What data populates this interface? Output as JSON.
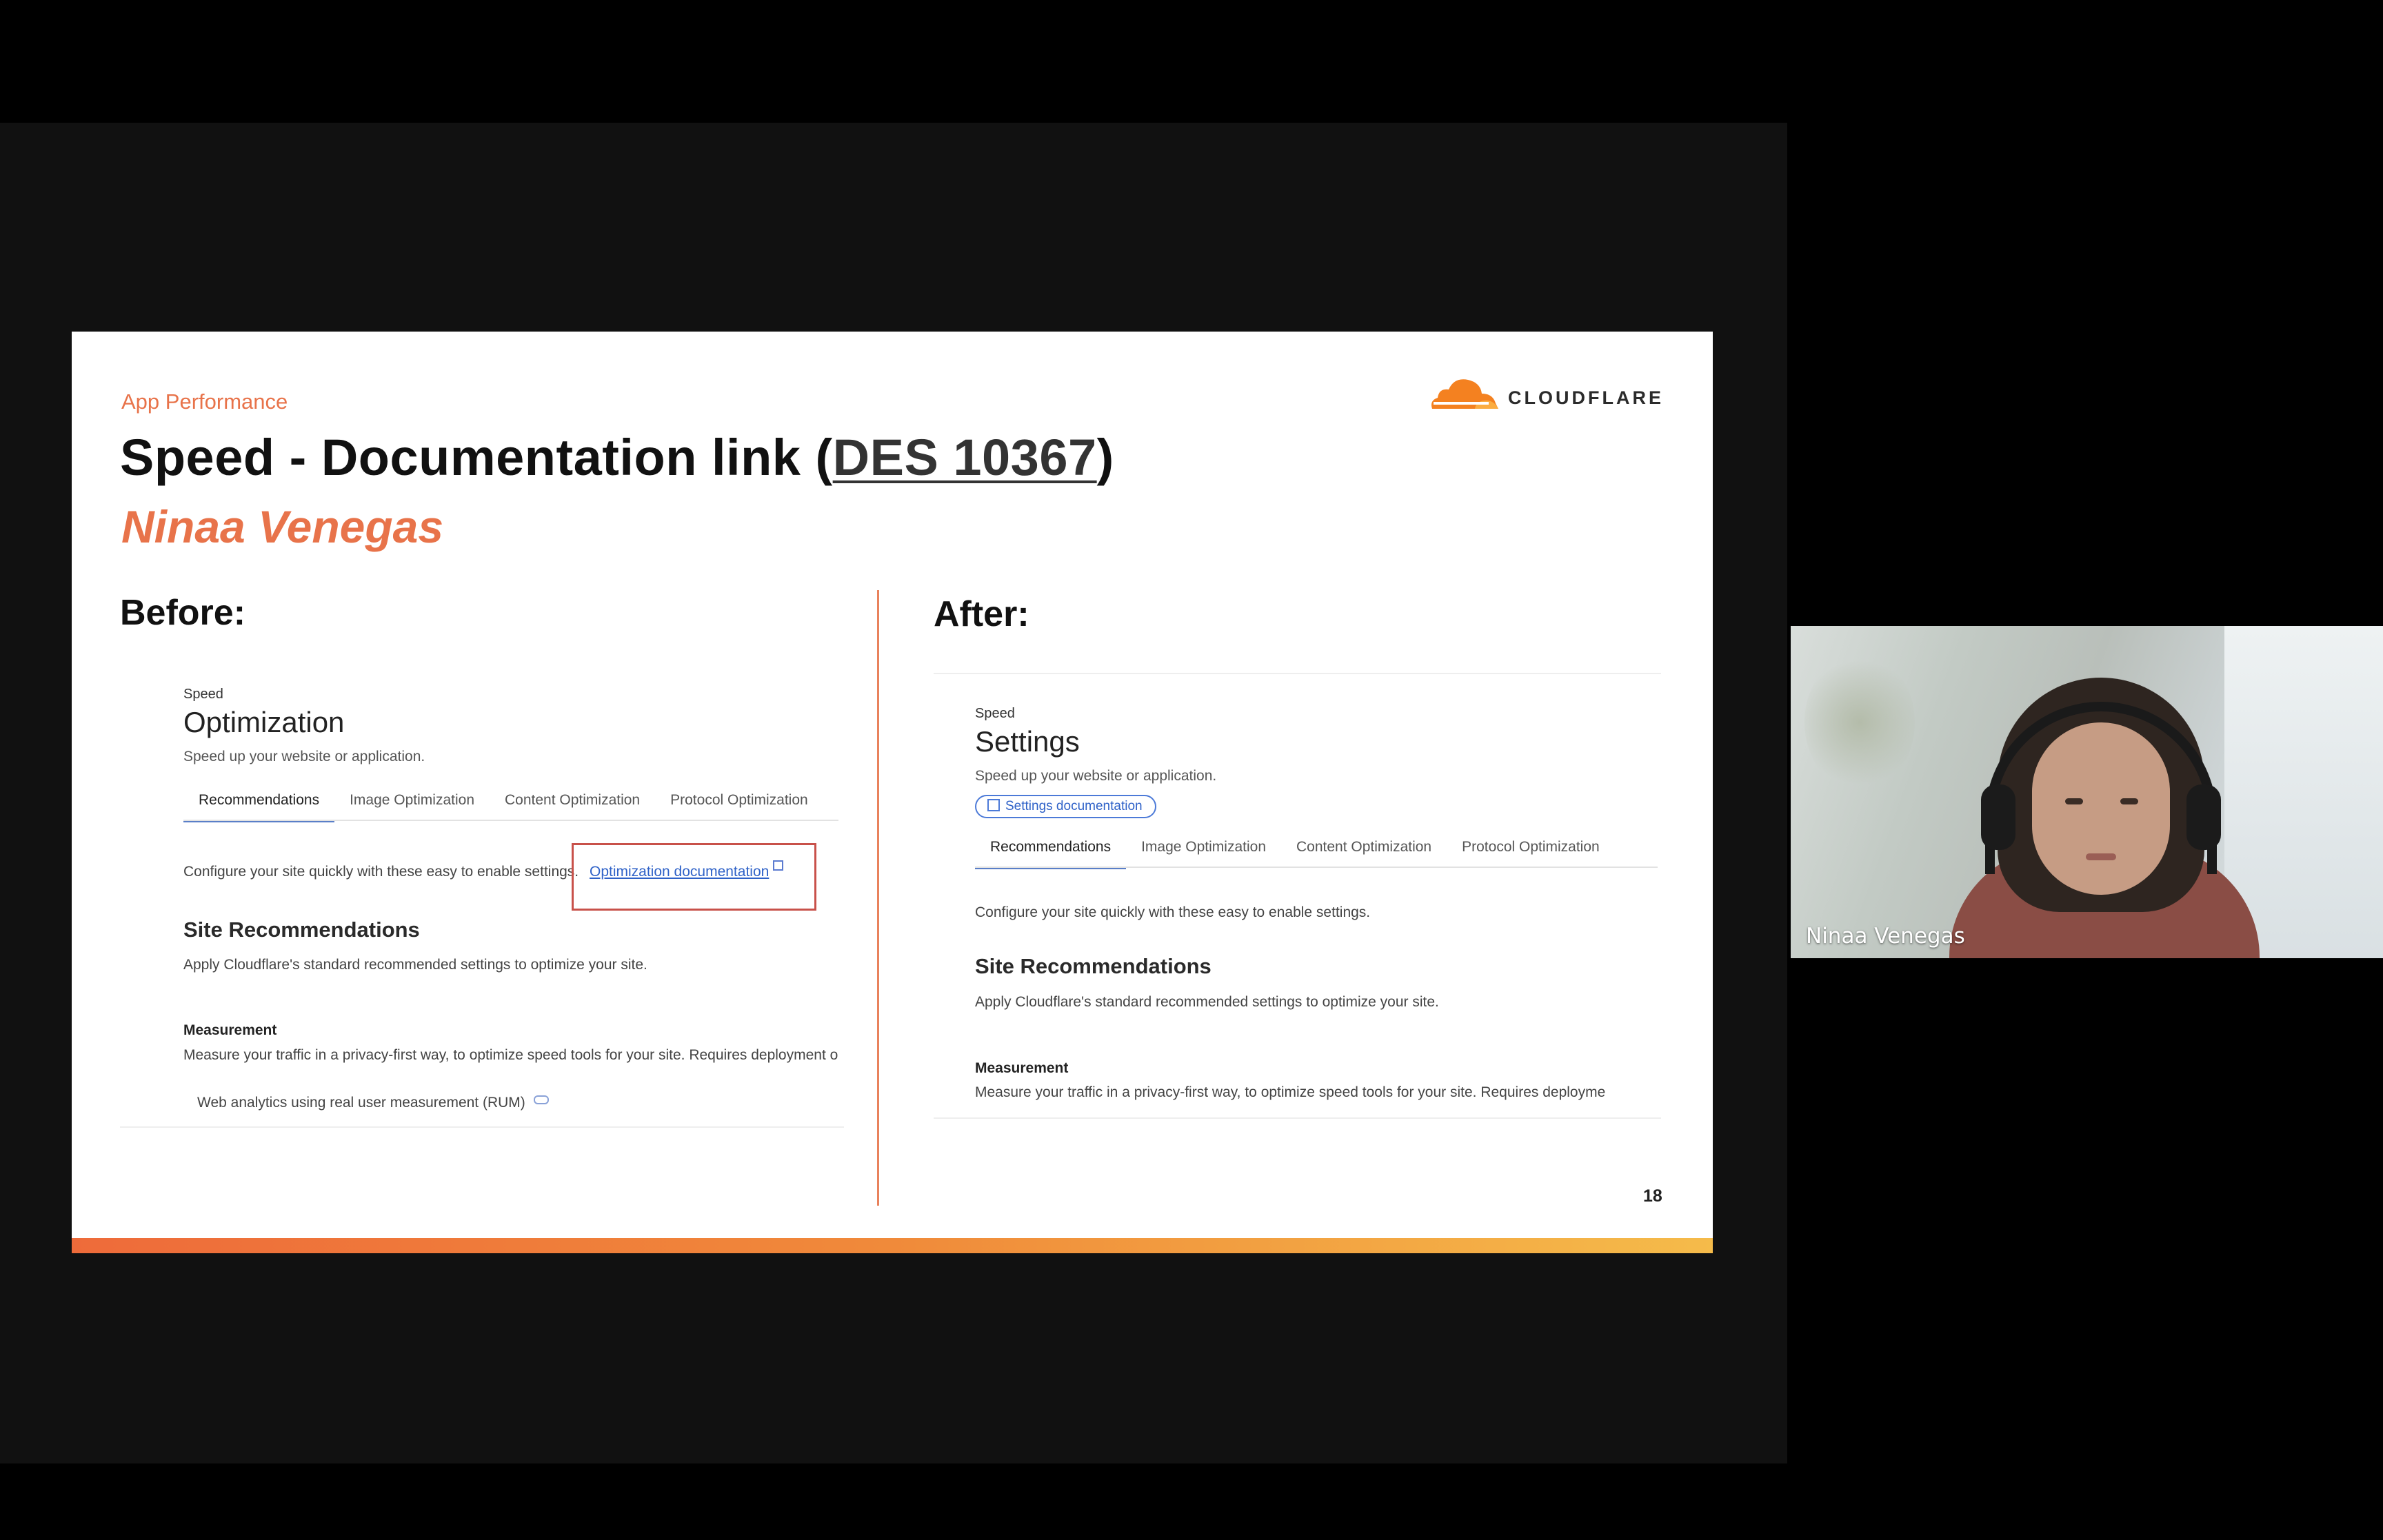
{
  "slide": {
    "eyebrow": "App Performance",
    "title_prefix": "Speed - Documentation link (",
    "title_link": "DES 10367",
    "title_suffix": ")",
    "subtitle": "Ninaa Venegas",
    "logo_text": "CLOUDFLARE",
    "page_number": "18",
    "before_label": "Before:",
    "after_label": "After:",
    "accent_color": "#e8734a"
  },
  "before": {
    "crumb": "Speed",
    "title": "Optimization",
    "description": "Speed up your website or application.",
    "tabs": [
      "Recommendations",
      "Image Optimization",
      "Content Optimization",
      "Protocol Optimization"
    ],
    "intro": "Configure your site quickly with these easy to enable settings.",
    "doc_link": "Optimization documentation",
    "section_title": "Site Recommendations",
    "section_desc": "Apply Cloudflare's standard recommended settings to optimize your site.",
    "measure_title": "Measurement",
    "measure_desc": "Measure your traffic in a privacy-first way, to optimize speed tools for your site. Requires deployment o",
    "rum_text": "Web analytics using real user measurement (RUM)"
  },
  "after": {
    "crumb": "Speed",
    "title": "Settings",
    "description": "Speed up your website or application.",
    "doc_pill": "Settings documentation",
    "tabs": [
      "Recommendations",
      "Image Optimization",
      "Content Optimization",
      "Protocol Optimization"
    ],
    "intro": "Configure your site quickly with these easy to enable settings.",
    "section_title": "Site Recommendations",
    "section_desc": "Apply Cloudflare's standard recommended settings to optimize your site.",
    "measure_title": "Measurement",
    "measure_desc": "Measure your traffic in a privacy-first way, to optimize speed tools for your site. Requires deployme"
  },
  "participant": {
    "name": "Ninaa Venegas"
  }
}
